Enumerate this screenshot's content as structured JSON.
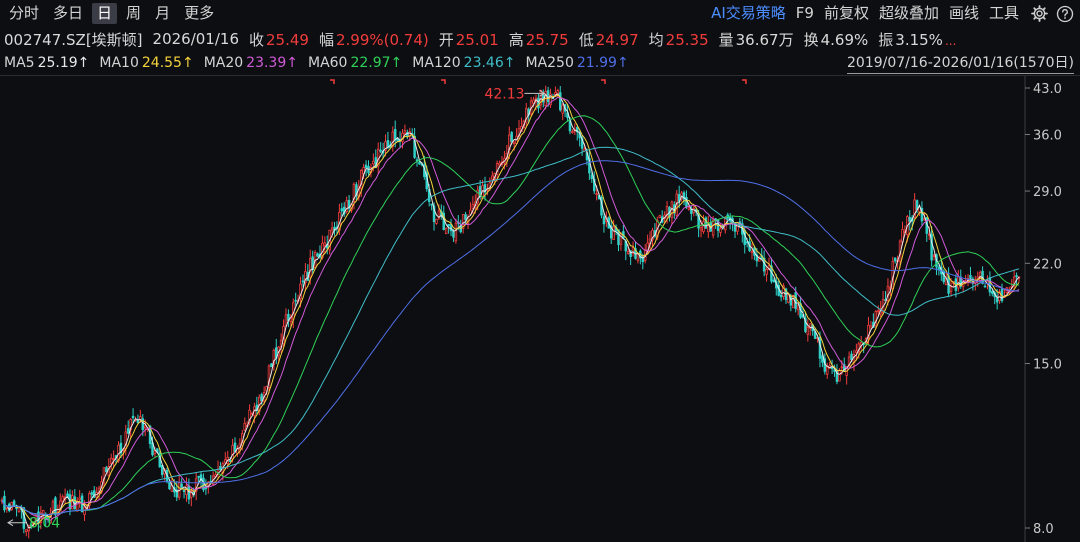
{
  "toolbar": {
    "period_tabs": [
      "分时",
      "多日",
      "日",
      "周",
      "月",
      "更多"
    ],
    "active_tab": "日",
    "tools": [
      "AI交易策略",
      "F9",
      "前复权",
      "超级叠加",
      "画线",
      "工具"
    ],
    "settings_icon": "gear-icon",
    "help_icon": "help-icon"
  },
  "quote": {
    "code_name": "002747.SZ[埃斯顿]",
    "date": "2026/01/16",
    "close_label": "收",
    "close": "25.49",
    "change_label": "幅",
    "change": "2.99%(0.74)",
    "open_label": "开",
    "open": "25.01",
    "high_label": "高",
    "high": "25.75",
    "low_label": "低",
    "low": "24.97",
    "avg_label": "均",
    "avg": "25.35",
    "volume_label": "量",
    "volume": "36.67万",
    "turnover_label": "换",
    "turnover": "4.69%",
    "amplitude_label": "振",
    "amplitude": "3.15%",
    "more": "..."
  },
  "ma_legend": [
    {
      "label": "MA5",
      "value": "25.19↑",
      "color": "#e8e8e8"
    },
    {
      "label": "MA10",
      "value": "24.55↑",
      "color": "#f5d23c"
    },
    {
      "label": "MA20",
      "value": "23.39↑",
      "color": "#d05ad8"
    },
    {
      "label": "MA60",
      "value": "22.97↑",
      "color": "#2fd158"
    },
    {
      "label": "MA120",
      "value": "23.46↑",
      "color": "#3fbdc8"
    },
    {
      "label": "MA250",
      "value": "21.99↑",
      "color": "#4f6fe8"
    }
  ],
  "range": "2019/07/16-2026/01/16(1570日)",
  "chart_data": {
    "type": "line",
    "yscale": "log",
    "ylim": [
      8.0,
      43.0
    ],
    "yticks": [
      43.0,
      36.0,
      29.0,
      22.0,
      15.0,
      8.0
    ],
    "annotations": {
      "max": "42.13",
      "min": "8.04"
    },
    "colors": {
      "up": "#f23c3c",
      "down": "#2fd1c8",
      "ma5": "#e8e8e8",
      "ma10": "#f5d23c",
      "ma20": "#d05ad8",
      "ma60": "#2fd158",
      "ma120": "#3fbdc8",
      "ma250": "#4f6fe8"
    },
    "x": [
      0,
      10,
      20,
      30,
      40,
      50,
      60,
      70,
      80,
      90,
      100,
      110,
      120,
      130,
      140,
      150,
      160,
      170,
      180,
      190,
      200,
      210,
      220,
      230,
      240,
      250,
      260,
      270,
      280,
      290,
      300,
      310,
      320,
      330,
      340,
      350,
      360,
      370,
      380,
      390,
      400,
      410,
      420,
      430,
      440,
      450,
      460,
      470,
      480,
      490,
      500,
      510,
      520,
      530,
      540,
      550,
      560,
      570,
      580,
      590,
      600,
      610,
      620,
      630,
      640,
      650,
      660,
      670,
      680,
      690,
      700,
      710,
      720,
      730,
      740,
      750,
      760,
      770,
      780,
      790,
      800,
      810,
      820,
      830,
      840,
      850,
      860,
      870,
      880,
      890,
      900,
      910,
      920,
      930,
      940,
      950,
      960,
      970,
      980,
      990
    ],
    "series": [
      {
        "name": "price",
        "values": [
          8.8,
          8.6,
          8.3,
          8.1,
          8.3,
          8.6,
          8.8,
          8.9,
          8.7,
          9.3,
          10.0,
          10.6,
          11.2,
          12.3,
          11.6,
          10.6,
          9.6,
          9.3,
          9.2,
          9.4,
          9.5,
          9.7,
          10.3,
          11.1,
          12.1,
          13.0,
          14.5,
          16.3,
          18.1,
          19.8,
          21.7,
          23.2,
          24.4,
          26.5,
          28.5,
          30.5,
          31.9,
          33.7,
          35.1,
          36.6,
          34.8,
          30.6,
          26.7,
          25.4,
          24.6,
          25.9,
          27.9,
          29.5,
          31.9,
          34.1,
          36.3,
          38.6,
          40.6,
          42.1,
          41.6,
          38.4,
          35.6,
          32.1,
          28.7,
          25.0,
          24.3,
          22.9,
          22.2,
          23.4,
          25.7,
          26.7,
          28.3,
          27.1,
          25.7,
          25.0,
          25.8,
          26.1,
          24.7,
          22.6,
          22.0,
          20.7,
          19.8,
          18.9,
          17.6,
          16.6,
          15.1,
          14.2,
          14.7,
          15.4,
          16.5,
          17.9,
          19.5,
          22.2,
          25.5,
          27.4,
          24.7,
          21.2,
          20.2,
          20.2,
          20.7,
          20.9,
          19.9,
          19.4,
          20.0,
          20.6
        ]
      }
    ]
  }
}
